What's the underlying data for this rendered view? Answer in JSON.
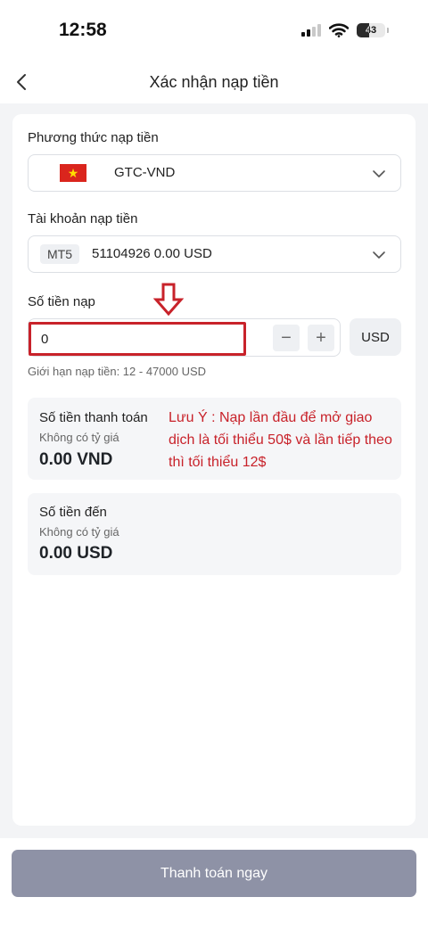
{
  "status_bar": {
    "time": "12:58",
    "battery": "43"
  },
  "header": {
    "title": "Xác nhận nạp tiền"
  },
  "deposit_method": {
    "label": "Phương thức nạp tiền",
    "value": "GTC-VND",
    "flag_icon": "vietnam-flag-icon"
  },
  "deposit_account": {
    "label": "Tài khoản nạp tiền",
    "platform_tag": "MT5",
    "value": "51104926 0.00 USD"
  },
  "amount": {
    "label": "Số tiền nạp",
    "value": "0",
    "minus": "−",
    "plus": "+",
    "currency": "USD",
    "limit": "Giới hạn nạp tiền: 12 - 47000 USD"
  },
  "payment_amount": {
    "title": "Số tiền thanh toán",
    "rate": "Không có tỷ giá",
    "value": "0.00 VND"
  },
  "received_amount": {
    "title": "Số tiền đến",
    "rate": "Không có tỷ giá",
    "value": "0.00 USD"
  },
  "annotation": {
    "note": "Lưu Ý : Nạp lần đầu để mở giao dịch là tối thiểu 50$ và lần tiếp theo thì tối thiểu 12$",
    "color": "#c8222a"
  },
  "footer": {
    "pay_button": "Thanh toán ngay",
    "button_color": "#8e92a6"
  }
}
